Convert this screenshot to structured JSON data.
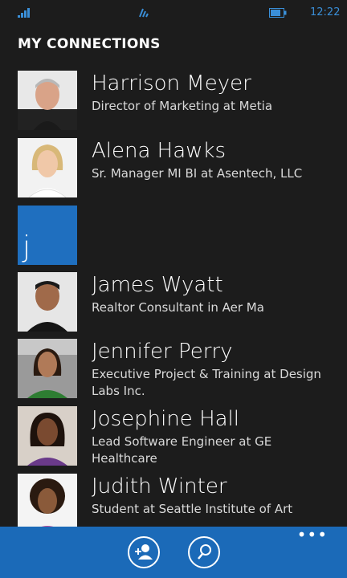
{
  "status": {
    "time": "12:22"
  },
  "page": {
    "title": "MY CONNECTIONS"
  },
  "connections": [
    {
      "name": "Harrison Meyer",
      "title": "Director of Marketing at Metia"
    },
    {
      "name": "Alena Hawks",
      "title": "Sr. Manager MI BI at Asentech, LLC"
    },
    {
      "name": "James Wyatt",
      "title": "Realtor Consultant in Aer Ma"
    },
    {
      "name": "Jennifer Perry",
      "title": "Executive Project & Training at Design Labs Inc."
    },
    {
      "name": "Josephine Hall",
      "title": "Lead Software Engineer at GE Healthcare"
    },
    {
      "name": "Judith Winter",
      "title": "Student at Seattle Institute of Art"
    }
  ],
  "jump_letter": "j",
  "appbar": {
    "more": "•••"
  },
  "colors": {
    "accent": "#1b6ab8",
    "jump_tile": "#1f6fbf",
    "background": "#1c1c1c"
  }
}
